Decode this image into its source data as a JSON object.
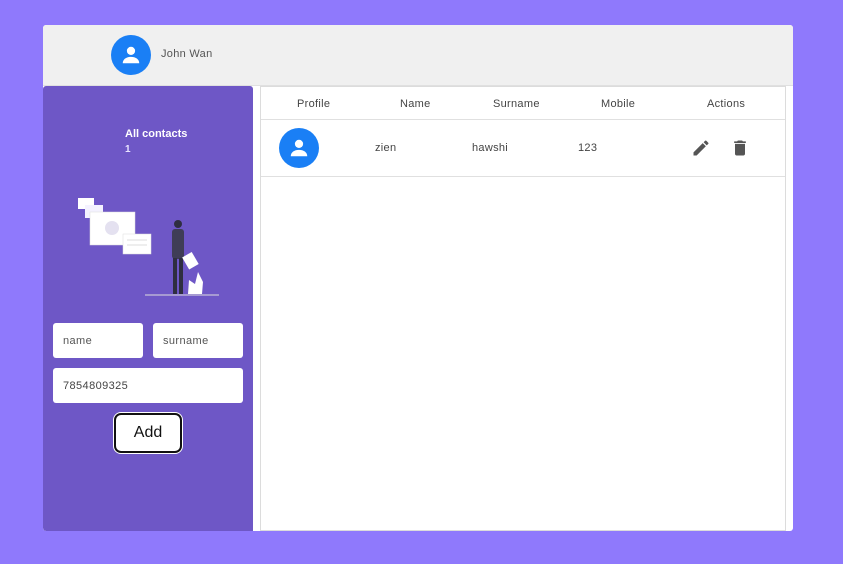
{
  "header": {
    "user_name": "John Wan"
  },
  "sidebar": {
    "stat_title": "All contacts",
    "stat_count": "1",
    "form": {
      "name_placeholder": "name",
      "surname_placeholder": "surname",
      "mobile_value": "7854809325",
      "add_label": "Add"
    }
  },
  "table": {
    "columns": [
      "Profile",
      "Name",
      "Surname",
      "Mobile",
      "Actions"
    ],
    "rows": [
      {
        "name": "zien",
        "surname": "hawshi",
        "mobile": "123"
      }
    ]
  },
  "colors": {
    "background": "#8f79fc",
    "sidebar": "#6e57c6",
    "avatar": "#1a7ff5",
    "icon": "#555555"
  },
  "icons": {
    "avatar": "user-icon",
    "edit": "pencil-icon",
    "delete": "trash-icon"
  }
}
